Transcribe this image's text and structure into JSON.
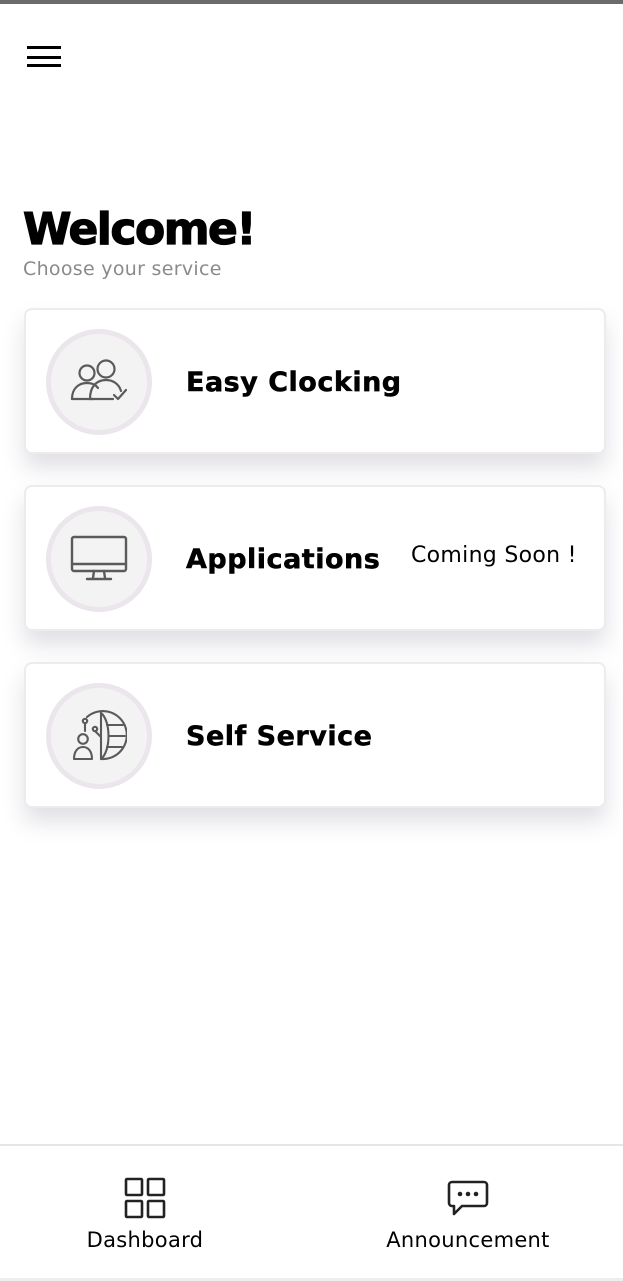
{
  "header": {
    "menu_icon": "hamburger-menu-icon"
  },
  "welcome": {
    "title": "Welcome!",
    "subtitle": "Choose your service"
  },
  "services": [
    {
      "label": "Easy Clocking",
      "icon": "users-check-icon",
      "badge": ""
    },
    {
      "label": "Applications",
      "icon": "monitor-icon",
      "badge": "Coming Soon !"
    },
    {
      "label": "Self Service",
      "icon": "person-globe-network-icon",
      "badge": ""
    }
  ],
  "bottom_nav": {
    "items": [
      {
        "label": "Dashboard",
        "icon": "grid-icon"
      },
      {
        "label": "Announcement",
        "icon": "chat-bubble-icon"
      }
    ]
  },
  "colors": {
    "card_border": "#ececec",
    "icon_circle_ring": "#ebe5ec",
    "icon_circle_fill": "#f4f3f4",
    "subtitle_text": "#8a8a8a",
    "icon_stroke": "#5a5a5a"
  }
}
